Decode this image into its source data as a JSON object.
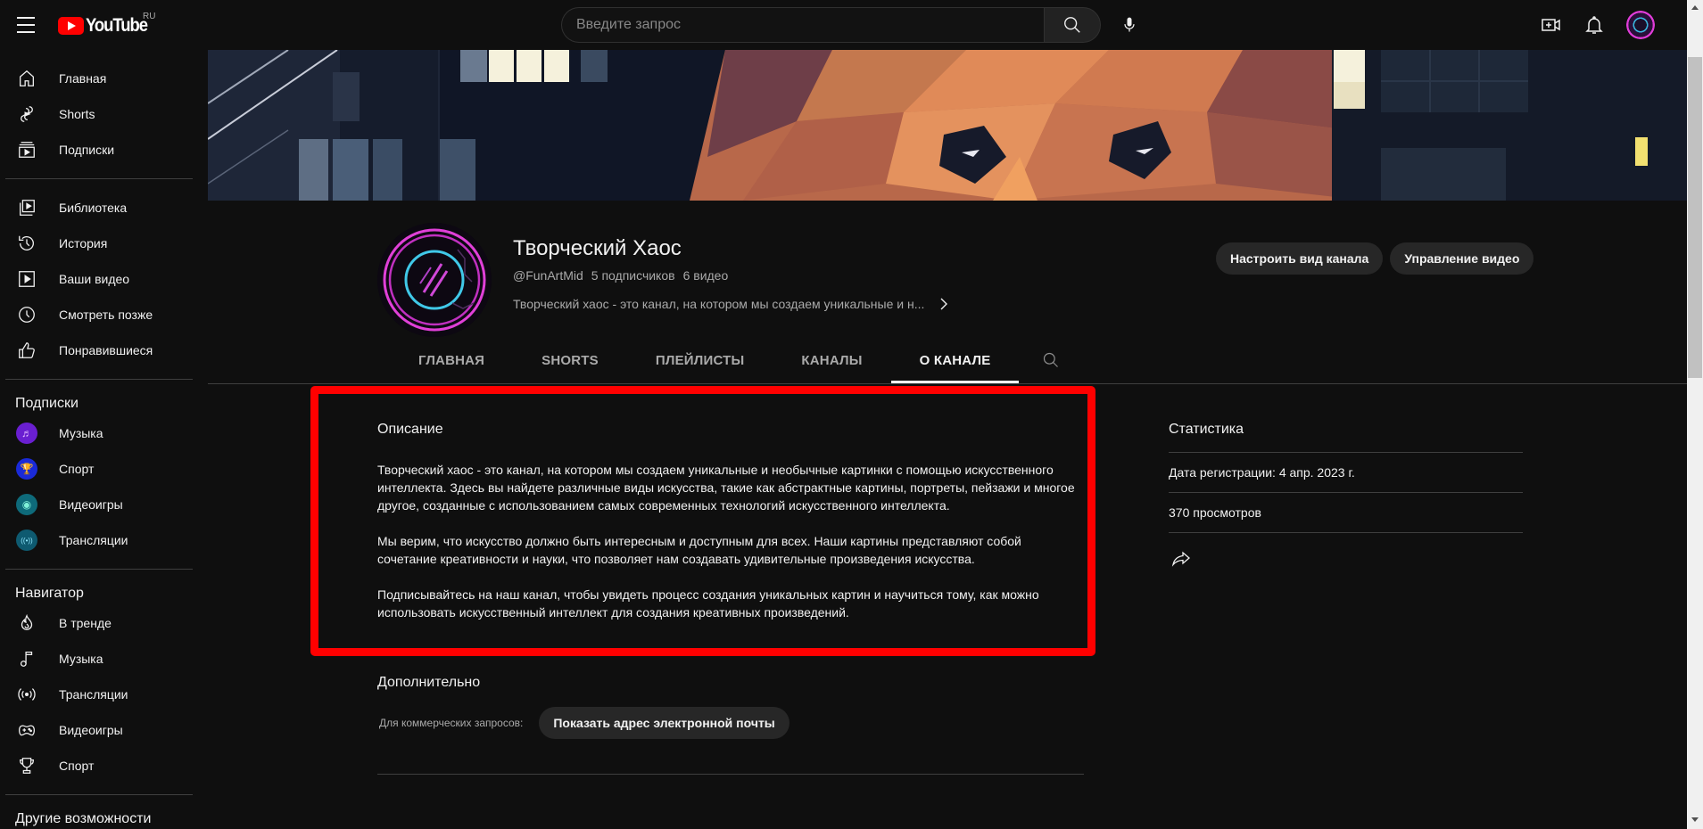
{
  "app": {
    "logo_text": "YouTube",
    "region": "RU"
  },
  "topbar": {
    "search_placeholder": "Введите запрос",
    "search_value": "",
    "icons": [
      "menu-icon",
      "search-icon",
      "microphone-icon",
      "create-video-icon",
      "notifications-bell-icon",
      "account-avatar"
    ]
  },
  "sidebar": {
    "main": [
      {
        "label": "Главная",
        "icon": "home-icon"
      },
      {
        "label": "Shorts",
        "icon": "shorts-icon"
      },
      {
        "label": "Подписки",
        "icon": "subscriptions-icon"
      }
    ],
    "library": [
      {
        "label": "Библиотека",
        "icon": "library-icon"
      },
      {
        "label": "История",
        "icon": "history-icon"
      },
      {
        "label": "Ваши видео",
        "icon": "your-videos-icon"
      },
      {
        "label": "Смотреть позже",
        "icon": "watch-later-icon"
      },
      {
        "label": "Понравившиеся",
        "icon": "liked-icon"
      }
    ],
    "subscriptions_heading": "Подписки",
    "subscriptions": [
      {
        "label": "Музыка",
        "icon": "music-channel-avatar",
        "color": "#6a1fd1"
      },
      {
        "label": "Спорт",
        "icon": "sport-channel-avatar",
        "color": "#1a2ad8"
      },
      {
        "label": "Видеоигры",
        "icon": "gaming-channel-avatar",
        "color": "#0e6a7a"
      },
      {
        "label": "Трансляции",
        "icon": "live-channel-avatar",
        "color": "#0e5a70"
      }
    ],
    "navigator_heading": "Навигатор",
    "navigator": [
      {
        "label": "В тренде",
        "icon": "trending-icon"
      },
      {
        "label": "Музыка",
        "icon": "music-icon"
      },
      {
        "label": "Трансляции",
        "icon": "live-icon"
      },
      {
        "label": "Видеоигры",
        "icon": "gaming-icon"
      },
      {
        "label": "Спорт",
        "icon": "sport-trophy-icon"
      }
    ],
    "more_heading": "Другие возможности"
  },
  "channel": {
    "title": "Творческий Хаос",
    "handle": "@FunArtMid",
    "subscribers": "5 подписчиков",
    "videos": "6 видео",
    "short_description": "Творческий хаос - это канал, на котором мы создаем уникальные и н...",
    "buttons": {
      "customize": "Настроить вид канала",
      "manage": "Управление видео"
    },
    "tabs": [
      {
        "label": "ГЛАВНАЯ",
        "active": false
      },
      {
        "label": "SHORTS",
        "active": false
      },
      {
        "label": "ПЛЕЙЛИСТЫ",
        "active": false
      },
      {
        "label": "КАНАЛЫ",
        "active": false
      },
      {
        "label": "О КАНАЛЕ",
        "active": true
      }
    ]
  },
  "about": {
    "description_title": "Описание",
    "description_paragraphs": [
      "Творческий хаос - это канал, на котором мы создаем уникальные и необычные картинки с помощью искусственного интеллекта. Здесь вы найдете различные виды искусства, такие как абстрактные картины, портреты, пейзажи и многое другое, созданные с использованием самых современных технологий искусственного интеллекта.",
      "Мы верим, что искусство должно быть интересным и доступным для всех. Наши картины представляют собой сочетание креативности и науки, что позволяет нам создавать удивительные произведения искусства.",
      "Подписывайтесь на наш канал, чтобы увидеть процесс создания уникальных картин и научиться тому, как можно использовать искусственный интеллект для создания креативных произведений."
    ],
    "extra_title": "Дополнительно",
    "business_label": "Для коммерческих запросов:",
    "show_email_button": "Показать адрес электронной почты",
    "highlight_color": "#ff0000"
  },
  "stats": {
    "title": "Статистика",
    "joined": "Дата регистрации: 4 апр. 2023 г.",
    "views": "370 просмотров",
    "share_icon": "share-icon"
  }
}
